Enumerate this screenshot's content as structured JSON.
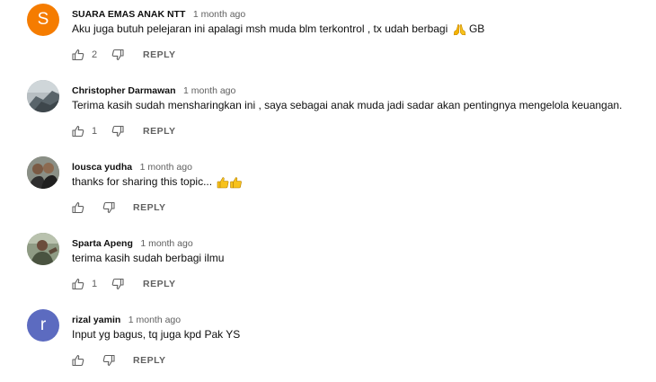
{
  "comments": [
    {
      "author": "SUARA EMAS ANAK NTT",
      "time": "1 month ago",
      "text": "Aku juga butuh pelejaran ini apalagi msh muda blm terkontrol , tx udah berbagi",
      "emoji_icon": "folded-hands-icon",
      "text_suffix": "GB",
      "likes": "2",
      "reply_label": "REPLY",
      "avatar_letter": "S",
      "avatar_color": "#f57c00"
    },
    {
      "author": "Christopher Darmawan",
      "time": "1 month ago",
      "text": "Terima kasih sudah mensharingkan ini , saya sebagai anak muda jadi sadar akan pentingnya mengelola keuangan.",
      "likes": "1",
      "reply_label": "REPLY",
      "avatar_icon": "photo-avatar-icon"
    },
    {
      "author": "lousca yudha",
      "time": "1 month ago",
      "text": "thanks for sharing this topic...",
      "emoji_icon": "thumbs-up-emoji-icon",
      "likes": "",
      "reply_label": "REPLY",
      "avatar_icon": "photo-avatar-icon"
    },
    {
      "author": "Sparta Apeng",
      "time": "1 month ago",
      "text": "terima kasih sudah berbagi ilmu",
      "likes": "1",
      "reply_label": "REPLY",
      "avatar_icon": "photo-avatar-icon"
    },
    {
      "author": "rizal yamin",
      "time": "1 month ago",
      "text": "Input yg bagus, tq juga kpd Pak YS",
      "likes": "",
      "reply_label": "REPLY",
      "avatar_letter": "r",
      "avatar_color": "#5c6bc0"
    }
  ],
  "colors": {
    "secondary_text": "#606060",
    "primary_text": "#0f0f0f"
  }
}
